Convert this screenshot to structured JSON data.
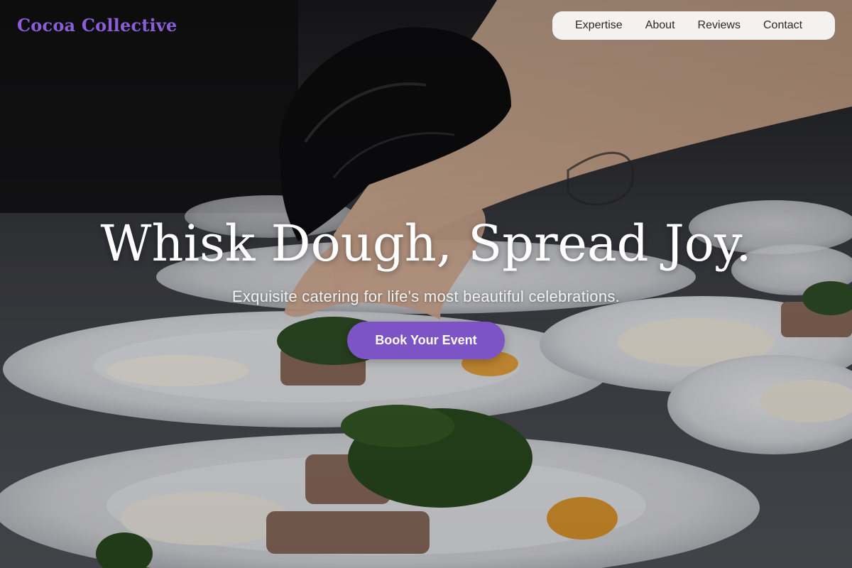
{
  "header": {
    "logo": "Cocoa Collective",
    "nav": [
      {
        "label": "Expertise"
      },
      {
        "label": "About"
      },
      {
        "label": "Reviews"
      },
      {
        "label": "Contact"
      }
    ]
  },
  "hero": {
    "headline": "Whisk Dough, Spread Joy.",
    "subhead": "Exquisite catering for life's most beautiful celebrations.",
    "cta_label": "Book Your Event",
    "background_image": "chef-gloved-hand-plating-dishes-photo"
  },
  "colors": {
    "brand": "#8a5fd6",
    "cta": "#7d54c6",
    "nav_bg": "#fafafa",
    "text_light": "#ffffff"
  }
}
